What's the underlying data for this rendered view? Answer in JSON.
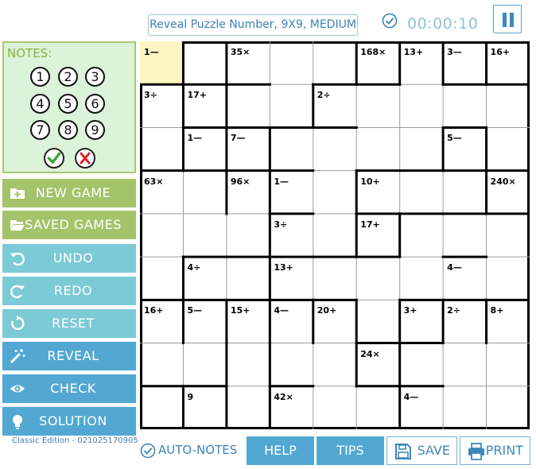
{
  "header": {
    "title": "Reveal Puzzle Number, 9X9, MEDIUM",
    "timer": "00:00:10",
    "check_icon": "check-circle-icon",
    "pause_icon": "pause-icon"
  },
  "notes": {
    "title": "NOTES:",
    "numbers": [
      "1",
      "2",
      "3",
      "4",
      "5",
      "6",
      "7",
      "8",
      "9"
    ],
    "confirm_icon": "green-check-icon",
    "cancel_icon": "red-x-icon"
  },
  "sidebar": {
    "new_game": "NEW GAME",
    "saved_games": "SAVED GAMES",
    "undo": "UNDO",
    "redo": "REDO",
    "reset": "RESET",
    "reveal": "REVEAL",
    "check": "CHECK",
    "solution": "SOLUTION",
    "edition": "Classic Edition - 021025170905"
  },
  "grid": {
    "size": 9,
    "highlight_cell": [
      0,
      0
    ],
    "clues": [
      {
        "r": 0,
        "c": 0,
        "t": "1—"
      },
      {
        "r": 0,
        "c": 2,
        "t": "35×"
      },
      {
        "r": 0,
        "c": 5,
        "t": "168×"
      },
      {
        "r": 0,
        "c": 6,
        "t": "13+"
      },
      {
        "r": 0,
        "c": 7,
        "t": "3—"
      },
      {
        "r": 0,
        "c": 8,
        "t": "16+"
      },
      {
        "r": 1,
        "c": 0,
        "t": "3÷"
      },
      {
        "r": 1,
        "c": 1,
        "t": "17+"
      },
      {
        "r": 1,
        "c": 4,
        "t": "2÷"
      },
      {
        "r": 2,
        "c": 1,
        "t": "1—"
      },
      {
        "r": 2,
        "c": 2,
        "t": "7—"
      },
      {
        "r": 2,
        "c": 7,
        "t": "5—"
      },
      {
        "r": 3,
        "c": 0,
        "t": "63×"
      },
      {
        "r": 3,
        "c": 2,
        "t": "96×"
      },
      {
        "r": 3,
        "c": 3,
        "t": "1—"
      },
      {
        "r": 3,
        "c": 5,
        "t": "10+"
      },
      {
        "r": 3,
        "c": 8,
        "t": "240×"
      },
      {
        "r": 4,
        "c": 3,
        "t": "3÷"
      },
      {
        "r": 4,
        "c": 5,
        "t": "17+"
      },
      {
        "r": 5,
        "c": 1,
        "t": "4÷"
      },
      {
        "r": 5,
        "c": 3,
        "t": "13+"
      },
      {
        "r": 5,
        "c": 7,
        "t": "4—"
      },
      {
        "r": 6,
        "c": 0,
        "t": "16+"
      },
      {
        "r": 6,
        "c": 1,
        "t": "5—"
      },
      {
        "r": 6,
        "c": 2,
        "t": "15+"
      },
      {
        "r": 6,
        "c": 3,
        "t": "4—"
      },
      {
        "r": 6,
        "c": 4,
        "t": "20+"
      },
      {
        "r": 6,
        "c": 6,
        "t": "3+"
      },
      {
        "r": 6,
        "c": 7,
        "t": "2÷"
      },
      {
        "r": 6,
        "c": 8,
        "t": "8+"
      },
      {
        "r": 7,
        "c": 5,
        "t": "24×"
      },
      {
        "r": 8,
        "c": 1,
        "t": "9"
      },
      {
        "r": 8,
        "c": 3,
        "t": "42×"
      },
      {
        "r": 8,
        "c": 6,
        "t": "4—"
      }
    ],
    "thick_v": [
      [
        0,
        1
      ],
      [
        0,
        2
      ],
      [
        0,
        5
      ],
      [
        0,
        6
      ],
      [
        0,
        7
      ],
      [
        0,
        8
      ],
      [
        1,
        1
      ],
      [
        1,
        2
      ],
      [
        1,
        4
      ],
      [
        2,
        1
      ],
      [
        2,
        2
      ],
      [
        2,
        3
      ],
      [
        2,
        7
      ],
      [
        2,
        8
      ],
      [
        3,
        2
      ],
      [
        3,
        3
      ],
      [
        3,
        5
      ],
      [
        3,
        8
      ],
      [
        4,
        3
      ],
      [
        4,
        5
      ],
      [
        4,
        6
      ],
      [
        5,
        1
      ],
      [
        5,
        3
      ],
      [
        6,
        1
      ],
      [
        6,
        2
      ],
      [
        6,
        3
      ],
      [
        6,
        4
      ],
      [
        6,
        5
      ],
      [
        6,
        6
      ],
      [
        6,
        7
      ],
      [
        6,
        8
      ],
      [
        7,
        2
      ],
      [
        7,
        3
      ],
      [
        7,
        5
      ],
      [
        7,
        6
      ],
      [
        8,
        1
      ],
      [
        8,
        2
      ],
      [
        8,
        3
      ],
      [
        8,
        6
      ]
    ],
    "thick_h": [
      [
        1,
        0
      ],
      [
        1,
        1
      ],
      [
        1,
        2
      ],
      [
        1,
        4
      ],
      [
        1,
        5
      ],
      [
        1,
        7
      ],
      [
        1,
        8
      ],
      [
        2,
        1
      ],
      [
        2,
        2
      ],
      [
        2,
        3
      ],
      [
        2,
        4
      ],
      [
        2,
        7
      ],
      [
        3,
        0
      ],
      [
        3,
        1
      ],
      [
        3,
        2
      ],
      [
        3,
        3
      ],
      [
        3,
        5
      ],
      [
        3,
        6
      ],
      [
        3,
        7
      ],
      [
        3,
        8
      ],
      [
        4,
        3
      ],
      [
        4,
        5
      ],
      [
        4,
        6
      ],
      [
        4,
        7
      ],
      [
        4,
        8
      ],
      [
        5,
        1
      ],
      [
        5,
        2
      ],
      [
        5,
        3
      ],
      [
        5,
        4
      ],
      [
        5,
        5
      ],
      [
        5,
        7
      ],
      [
        6,
        0
      ],
      [
        6,
        1
      ],
      [
        6,
        2
      ],
      [
        6,
        3
      ],
      [
        6,
        4
      ],
      [
        6,
        6
      ],
      [
        6,
        7
      ],
      [
        6,
        8
      ],
      [
        7,
        5
      ],
      [
        7,
        6
      ],
      [
        8,
        0
      ],
      [
        8,
        1
      ],
      [
        8,
        3
      ],
      [
        8,
        5
      ],
      [
        8,
        6
      ]
    ]
  },
  "bottom": {
    "auto_notes": "AUTO-NOTES",
    "help": "HELP",
    "tips": "TIPS",
    "save": "SAVE",
    "print": "PRINT"
  },
  "colors": {
    "highlight": "#fdf6c3",
    "green": "#a3c46a",
    "light_blue": "#7ccad6",
    "blue": "#52a8d2"
  }
}
